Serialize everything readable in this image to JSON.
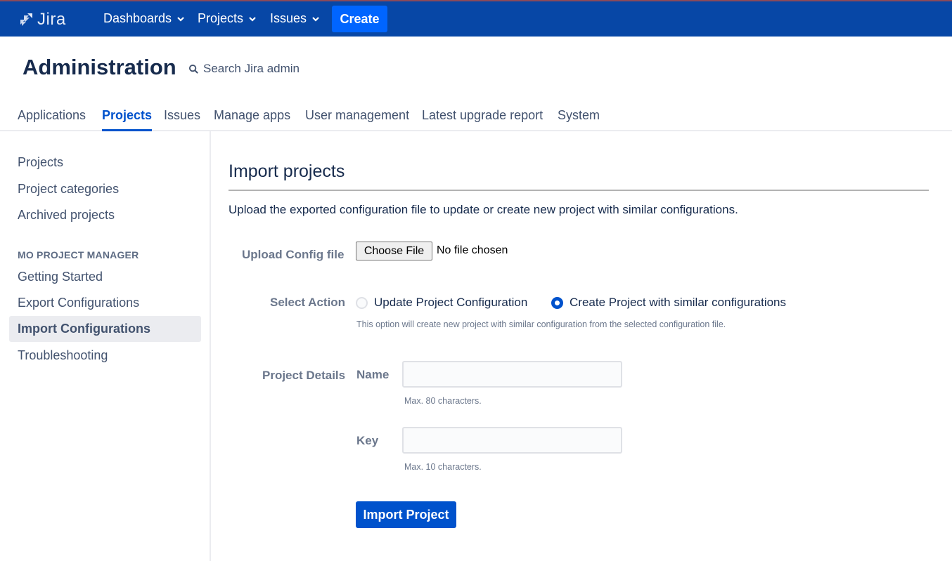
{
  "topnav": {
    "logo_text": "Jira",
    "items": [
      {
        "label": "Dashboards"
      },
      {
        "label": "Projects"
      },
      {
        "label": "Issues"
      }
    ],
    "create_label": "Create",
    "colors": {
      "bar": "#0747a6",
      "create": "#0065ff"
    }
  },
  "header": {
    "title": "Administration",
    "search_label": "Search Jira admin"
  },
  "tabs": [
    {
      "label": "Applications",
      "active": false
    },
    {
      "label": "Projects",
      "active": true
    },
    {
      "label": "Issues",
      "active": false
    },
    {
      "label": "Manage apps",
      "active": false
    },
    {
      "label": "User management",
      "active": false
    },
    {
      "label": "Latest upgrade report",
      "active": false
    },
    {
      "label": "System",
      "active": false
    }
  ],
  "sidebar": {
    "items": [
      {
        "label": "Projects"
      },
      {
        "label": "Project categories"
      },
      {
        "label": "Archived projects"
      }
    ],
    "section_heading": "MO PROJECT MANAGER",
    "section_items": [
      {
        "label": "Getting Started",
        "active": false
      },
      {
        "label": "Export Configurations",
        "active": false
      },
      {
        "label": "Import Configurations",
        "active": true
      },
      {
        "label": "Troubleshooting",
        "active": false
      }
    ]
  },
  "main": {
    "title": "Import projects",
    "intro": "Upload the exported configuration file to update or create new project with similar configurations.",
    "upload": {
      "label": "Upload Config file",
      "button_label": "Choose File",
      "status": "No file chosen"
    },
    "action": {
      "label": "Select Action",
      "options": [
        {
          "label": "Update Project Configuration",
          "checked": false
        },
        {
          "label": "Create Project with similar configurations",
          "checked": true
        }
      ],
      "help": "This option will create new project with similar configuration from the selected configuration file."
    },
    "details": {
      "label": "Project Details",
      "name_label": "Name",
      "name_value": "",
      "name_help": "Max. 80 characters.",
      "key_label": "Key",
      "key_value": "",
      "key_help": "Max. 10 characters."
    },
    "submit_label": "Import Project"
  }
}
